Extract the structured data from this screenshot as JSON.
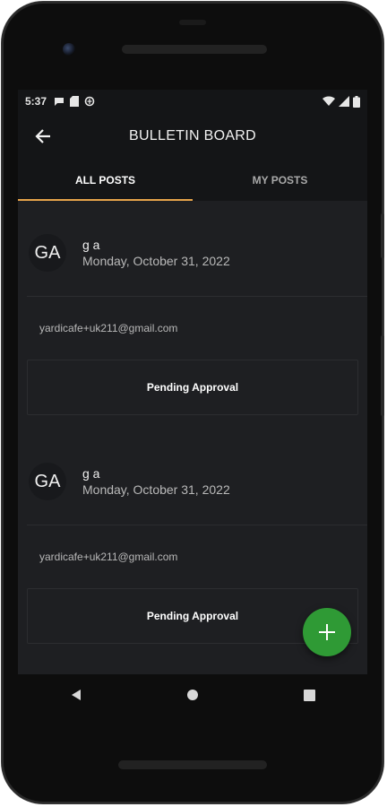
{
  "status_bar": {
    "time": "5:37",
    "left_icons": [
      "chat-bubble-icon",
      "sd-card-icon",
      "data-saver-icon"
    ],
    "right_icons": [
      "wifi-icon",
      "signal-icon",
      "battery-icon"
    ]
  },
  "appbar": {
    "title": "BULLETIN BOARD",
    "back_icon": "back-arrow-icon"
  },
  "tabs": [
    {
      "label": "ALL POSTS",
      "active": true
    },
    {
      "label": "MY POSTS",
      "active": false
    }
  ],
  "posts": [
    {
      "avatar_initials": "GA",
      "name": "g a",
      "date": "Monday, October 31, 2022",
      "email": "yardicafe+uk211@gmail.com",
      "status": "Pending Approval"
    },
    {
      "avatar_initials": "GA",
      "name": "g a",
      "date": "Monday, October 31, 2022",
      "email": "yardicafe+uk211@gmail.com",
      "status": "Pending Approval"
    }
  ],
  "fab": {
    "icon": "plus-icon"
  },
  "nav": {
    "back": "nav-back-icon",
    "home": "nav-home-icon",
    "recents": "nav-recents-icon"
  },
  "colors": {
    "background": "#1e1f22",
    "bar": "#141517",
    "accent": "#e6a34a",
    "fab": "#2f9a35"
  }
}
